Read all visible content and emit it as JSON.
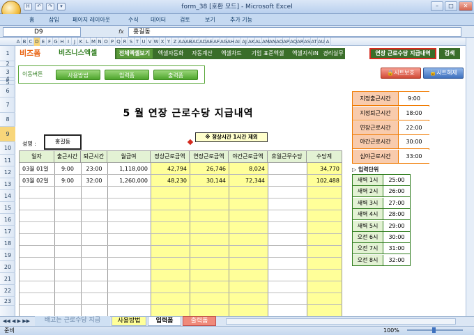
{
  "window": {
    "title": "form_38  [호환 모드] - Microsoft Excel",
    "min": "–",
    "max": "□",
    "close": "✕"
  },
  "qat": {
    "save": "H",
    "undo": "↶",
    "redo": "↷",
    "more": "▾"
  },
  "ribbon_tabs": [
    "홈",
    "삽입",
    "페이지 레이아웃",
    "수식",
    "데이터",
    "검토",
    "보기",
    "추가 기능"
  ],
  "name_box": "D9",
  "formula": "홍길동",
  "fx": "fx",
  "columns": [
    "A",
    "B",
    "C",
    "D",
    "E",
    "F",
    "G",
    "H",
    "I",
    "J",
    "K",
    "L",
    "M",
    "N",
    "O",
    "P",
    "Q",
    "R",
    "S",
    "T",
    "U",
    "V",
    "W",
    "X",
    "Y",
    "Z",
    "AA",
    "AB",
    "AC",
    "AD",
    "AE",
    "AF",
    "AG",
    "AH",
    "AI",
    "AJ",
    "AK",
    "AL",
    "AM",
    "AN",
    "AO",
    "AP",
    "AQ",
    "AR",
    "AS",
    "AT",
    "AU",
    "A"
  ],
  "rows": [
    "1",
    "2",
    "3",
    "4",
    "5",
    "6",
    "7",
    "8",
    "9",
    "10",
    "11",
    "12",
    "13",
    "14",
    "15",
    "16",
    "17",
    "18",
    "19",
    "20",
    "21",
    "22",
    "23"
  ],
  "banner": {
    "logo1": "비즈폼",
    "logo2": "비즈니스엑셀",
    "menu": [
      "전체엑셀보기",
      "엑셀자동화",
      "자동계산",
      "엑셀차트",
      "기업 표준엑셀",
      "엑셀지식iN",
      "경리실무"
    ],
    "highlight": "연장 근로수당 지급내역",
    "search": "검색"
  },
  "nav": {
    "label": "이동버튼",
    "buttons": [
      "사용방법",
      "입력폼",
      "출력폼"
    ]
  },
  "protect": {
    "lock": "시트보호",
    "unlock": "시트해제"
  },
  "report": {
    "title": "5 월 연장 근로수당 지급내역",
    "name_label": "성명 :",
    "name_value": "홍길동",
    "note": "※ 정상시간 1시간 제외",
    "headers": [
      "일자",
      "출근시간",
      "퇴근시간",
      "월급여",
      "정상근로금액",
      "연장근로금액",
      "야간근로금액",
      "휴일근무수당",
      "수당계"
    ],
    "rows": [
      [
        "03월 01일",
        "9:00",
        "23:00",
        "1,118,000",
        "42,794",
        "26,746",
        "8,024",
        "",
        "34,770"
      ],
      [
        "03월 02일",
        "9:00",
        "32:00",
        "1,260,000",
        "48,230",
        "30,144",
        "72,344",
        "",
        "102,488"
      ]
    ]
  },
  "settings": [
    {
      "label": "지정출근시간",
      "value": "9:00"
    },
    {
      "label": "지정퇴근시간",
      "value": "18:00"
    },
    {
      "label": "연장근로시간",
      "value": "22:00"
    },
    {
      "label": "야간근로시간",
      "value": "30:00"
    },
    {
      "label": "심야근로시간",
      "value": "33:00"
    }
  ],
  "units": {
    "title": "▷ 입력단위",
    "rows": [
      {
        "label": "새벽 1시",
        "value": "25:00"
      },
      {
        "label": "새벽 2시",
        "value": "26:00"
      },
      {
        "label": "새벽 3시",
        "value": "27:00"
      },
      {
        "label": "새벽 4시",
        "value": "28:00"
      },
      {
        "label": "새벽 5시",
        "value": "29:00"
      },
      {
        "label": "오전 6시",
        "value": "30:00"
      },
      {
        "label": "오전 7시",
        "value": "31:00"
      },
      {
        "label": "오전 8시",
        "value": "32:00"
      }
    ]
  },
  "sheet_tabs": [
    "배고는 근로수당 지급",
    "사용방법",
    "입력폼",
    "출력폼"
  ],
  "status": {
    "ready": "준비",
    "zoom": "100%"
  },
  "colors": {
    "green_dark": "#2f7d1e",
    "yellow_col": "#ffff99",
    "orange_border": "#f07a00",
    "salmon": "#f8cbad"
  }
}
